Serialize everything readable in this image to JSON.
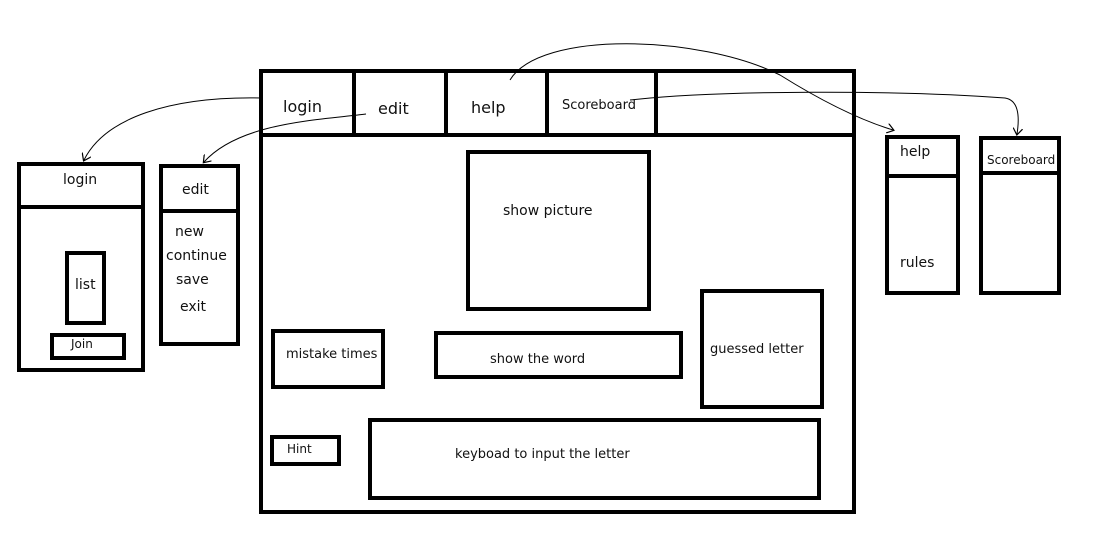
{
  "main_menu": {
    "login": "login",
    "edit": "edit",
    "help": "help",
    "scoreboard": "Scoreboard"
  },
  "main_area": {
    "show_picture": "show picture",
    "mistake_times": "mistake times",
    "show_word": "show the word",
    "guessed_letter": "guessed letter",
    "hint": "Hint",
    "keyboard": "keyboad to input the letter"
  },
  "login_panel": {
    "title": "login",
    "list": "list",
    "join": "Join"
  },
  "edit_panel": {
    "title": "edit",
    "items": [
      "new",
      "continue",
      "save",
      "exit"
    ]
  },
  "help_panel": {
    "title": "help",
    "rules": "rules"
  },
  "scoreboard_panel": {
    "title": "Scoreboard"
  }
}
